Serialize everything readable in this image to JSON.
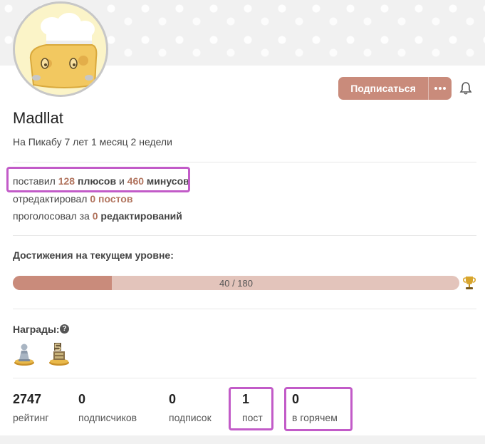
{
  "profile": {
    "username": "Madllat",
    "tenure": "На Пикабу 7 лет 1 месяц 2 недели"
  },
  "header": {
    "subscribe_label": "Подписаться",
    "more_label": "•••",
    "bell_icon": "bell-icon"
  },
  "activity": {
    "votes": {
      "prefix": "поставил",
      "plus_count": "128",
      "plus_word": "плюсов",
      "conj": "и",
      "minus_count": "460",
      "minus_word": "минусов"
    },
    "edits": {
      "prefix": "отредактировал",
      "count": "0",
      "word": "постов"
    },
    "votes_edits": {
      "prefix": "проголосовал за",
      "count": "0",
      "word": "редактирований"
    }
  },
  "achievements": {
    "title": "Достижения на текущем уровне:",
    "current": 40,
    "total": 180,
    "text": "40 / 180",
    "trophy_icon": "trophy-icon"
  },
  "awards": {
    "title": "Награды:",
    "help_icon": "question-circle-icon",
    "items": [
      {
        "icon": "pawn-award-icon"
      },
      {
        "icon": "five-years-award-icon"
      }
    ]
  },
  "stats": [
    {
      "value": "2747",
      "label": "рейтинг"
    },
    {
      "value": "0",
      "label": "подписчиков"
    },
    {
      "value": "0",
      "label": "подписок"
    },
    {
      "value": "1",
      "label": "пост"
    },
    {
      "value": "0",
      "label": "в горячем"
    }
  ],
  "colors": {
    "accent": "#c98b7b",
    "accent_light": "#e3c4bb",
    "number": "#b1745e",
    "highlight": "#c25bc8"
  }
}
